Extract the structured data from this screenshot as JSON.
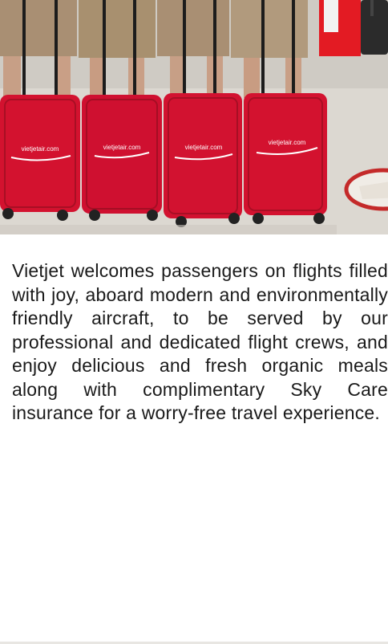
{
  "hero": {
    "image_alt": "Four red Vietjet suitcases lined up on an airport floor",
    "luggage_brand_text": "vietjetair.com",
    "colors": {
      "suitcase_red": "#d3122f",
      "floor": "#d9d5cf",
      "sign_red": "#e31b23"
    }
  },
  "article": {
    "paragraph": "Vietjet welcomes passengers on flights filled with joy, aboard modern and environmentally friendly aircraft, to be served by our professional and dedicated flight crews, and enjoy delicious and fresh organic meals along with complimentary Sky Care insurance for a worry-free travel experience."
  }
}
